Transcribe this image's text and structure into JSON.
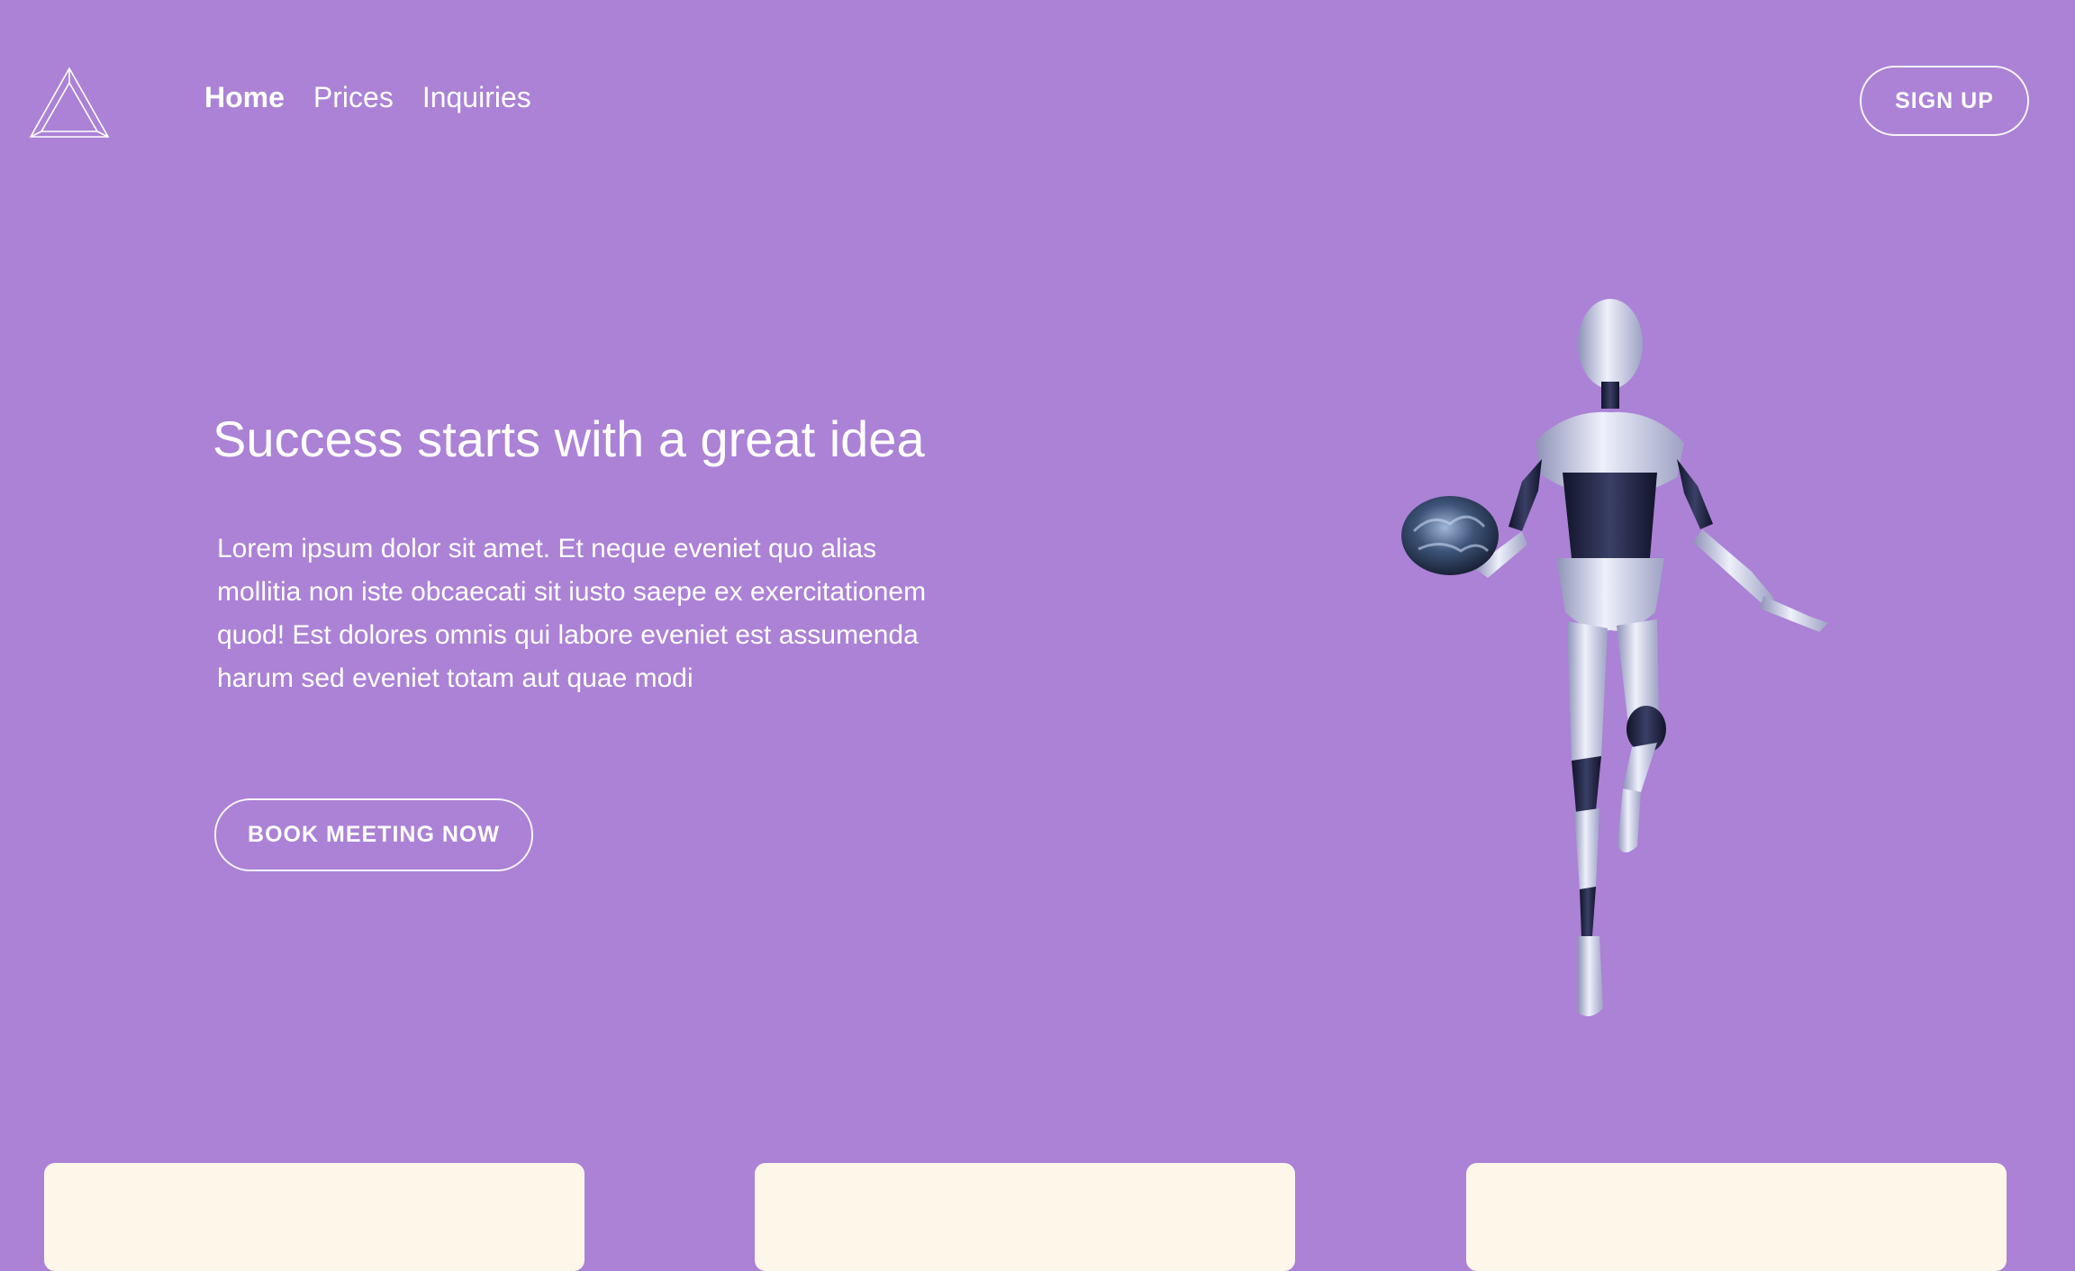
{
  "header": {
    "logo_icon": "triangle-logo-icon",
    "nav": {
      "home": "Home",
      "prices": "Prices",
      "inquiries": "Inquiries"
    },
    "signup_label": "SIGN UP"
  },
  "hero": {
    "title": "Success starts with a great idea",
    "body": "Lorem ipsum dolor sit amet. Et neque eveniet quo alias mollitia non iste obcaecati sit iusto saepe ex exercitationem quod! Est dolores omnis qui labore eveniet est assumenda harum sed eveniet totam aut quae modi",
    "cta_label": "BOOK MEETING NOW",
    "illustration": "robot-holding-brain-image"
  },
  "colors": {
    "background": "#ab82d6",
    "card": "#fdf7e9",
    "text": "#ffffff"
  }
}
